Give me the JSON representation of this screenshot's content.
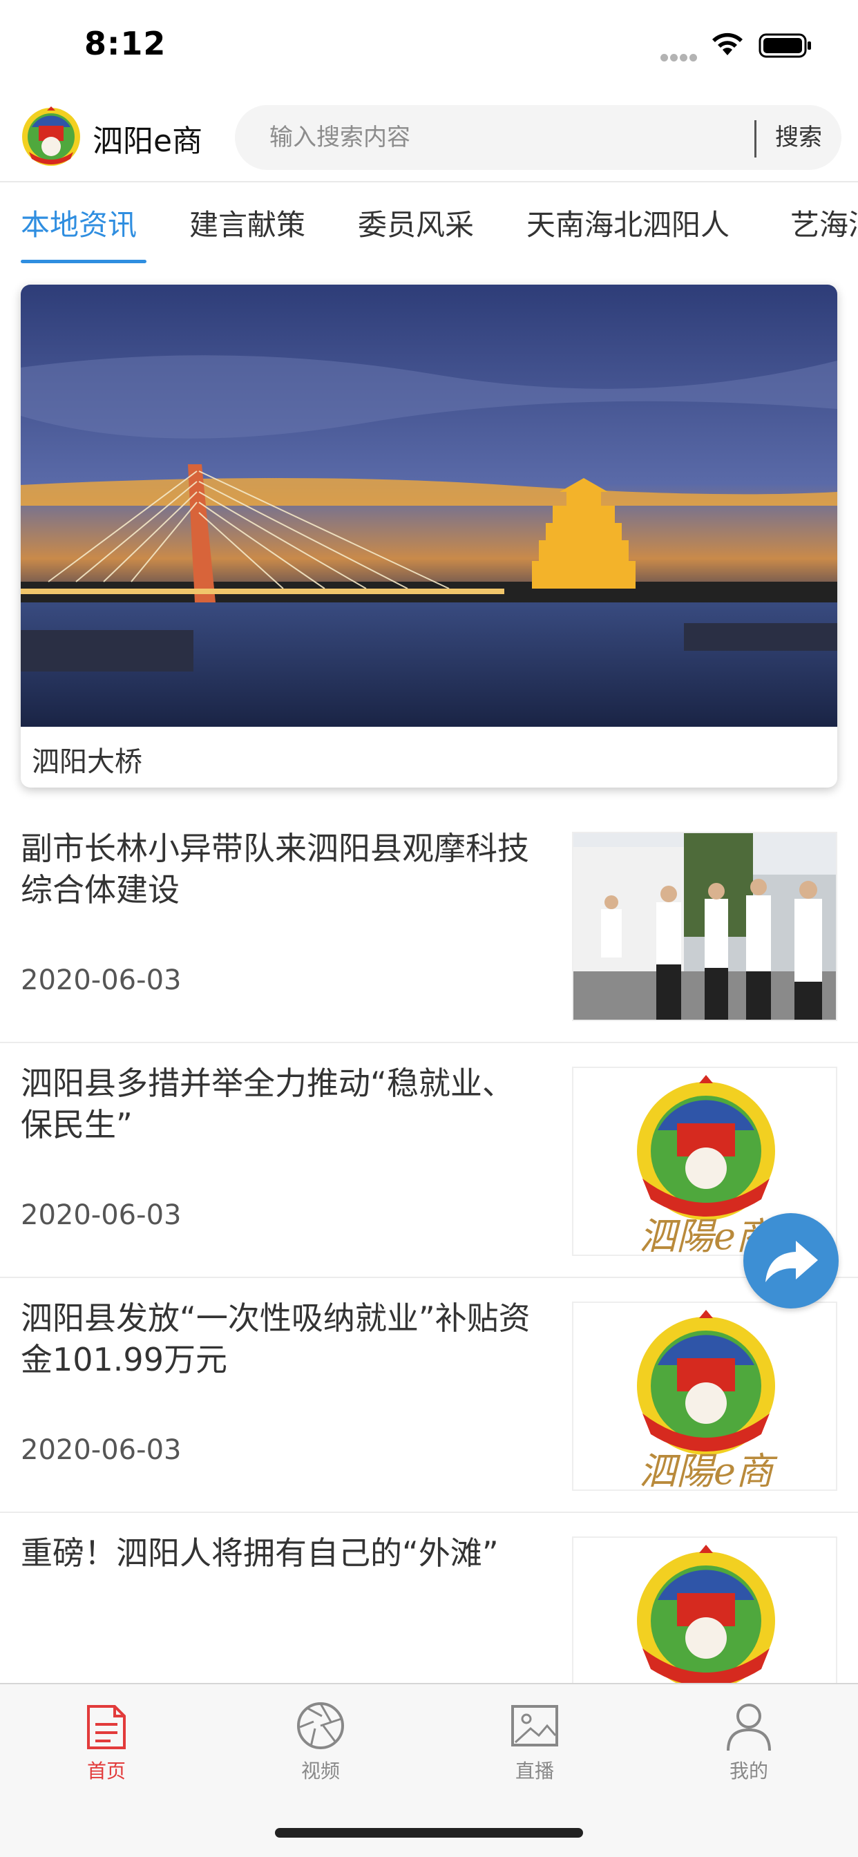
{
  "status_bar": {
    "time": "8:12"
  },
  "header": {
    "app_name": "泗阳e商",
    "search_placeholder": "输入搜索内容",
    "search_button": "搜索"
  },
  "tabs": [
    {
      "label": "本地资讯",
      "active": true
    },
    {
      "label": "建言献策",
      "active": false
    },
    {
      "label": "委员风采",
      "active": false
    },
    {
      "label": "天南海北泗阳人",
      "active": false
    },
    {
      "label": "艺海泗",
      "active": false
    }
  ],
  "banner": {
    "caption": "泗阳大桥"
  },
  "news": [
    {
      "title": "副市长林小异带队来泗阳县观摩科技综合体建设",
      "date": "2020-06-03",
      "thumb": "photo"
    },
    {
      "title": "泗阳县多措并举全力推动“稳就业、保民生”",
      "date": "2020-06-03",
      "thumb": "logo"
    },
    {
      "title": "泗阳县发放“一次性吸纳就业”补贴资金101.99万元",
      "date": "2020-06-03",
      "thumb": "logo"
    },
    {
      "title": "重磅！泗阳人将拥有自己的“外滩”",
      "date": "",
      "thumb": "logo"
    }
  ],
  "logo_text": "泗陽e商",
  "tabbar": [
    {
      "label": "首页",
      "icon": "document-icon",
      "active": true
    },
    {
      "label": "视频",
      "icon": "aperture-icon",
      "active": false
    },
    {
      "label": "直播",
      "icon": "image-icon",
      "active": false
    },
    {
      "label": "我的",
      "icon": "person-icon",
      "active": false
    }
  ],
  "colors": {
    "accent": "#2f8ee0",
    "tabbar_active": "#e23b3b",
    "share_button": "#3d8fd4"
  }
}
